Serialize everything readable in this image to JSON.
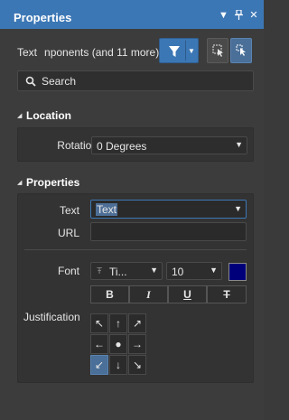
{
  "window": {
    "title": "Properties",
    "icons": [
      "dropdown-icon",
      "pin-icon",
      "close-icon"
    ]
  },
  "filter": {
    "label": "Text",
    "summary": "nponents (and 11 more)"
  },
  "search": {
    "placeholder": "Search"
  },
  "location": {
    "header": "Location",
    "rotation_label": "Rotation",
    "rotation_value": "0 Degrees"
  },
  "properties": {
    "header": "Properties",
    "text_label": "Text",
    "text_value": "Text",
    "url_label": "URL",
    "url_value": "",
    "font_label": "Font",
    "font_name": "Ti...",
    "font_size": "10",
    "font_color": "#00007a",
    "style_buttons": [
      "B",
      "I",
      "U",
      "T"
    ],
    "justification_label": "Justification",
    "justification_grid": [
      "↖",
      "↑",
      "↗",
      "←",
      "●",
      "→",
      "↙",
      "↓",
      "↘"
    ],
    "justification_selected": "bottom-left"
  }
}
